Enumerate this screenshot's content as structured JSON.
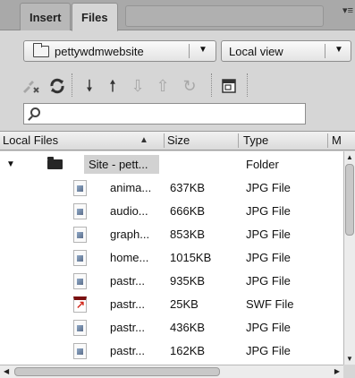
{
  "tabs": [
    {
      "label": "Insert",
      "active": false
    },
    {
      "label": "Files",
      "active": true
    }
  ],
  "site_select": {
    "value": "pettywdmwebsite"
  },
  "view_select": {
    "value": "Local view"
  },
  "toolbar": {
    "icons": [
      "connect-icon",
      "refresh-icon",
      "get-files-icon",
      "put-files-icon",
      "check-out-icon",
      "check-in-icon",
      "synchronize-icon",
      "expand-icon"
    ]
  },
  "search": {
    "value": "",
    "placeholder": ""
  },
  "columns": [
    "Local Files",
    "Size",
    "Type",
    "M"
  ],
  "sort": {
    "column": "Local Files",
    "direction": "ascending"
  },
  "tree": {
    "root": {
      "name": "Site - pett...",
      "type": "Folder",
      "expanded": true
    },
    "files": [
      {
        "name": "anima...",
        "size": "637KB",
        "type": "JPG File",
        "icon": "jpg-file-icon"
      },
      {
        "name": "audio...",
        "size": "666KB",
        "type": "JPG File",
        "icon": "jpg-file-icon"
      },
      {
        "name": "graph...",
        "size": "853KB",
        "type": "JPG File",
        "icon": "jpg-file-icon"
      },
      {
        "name": "home...",
        "size": "1015KB",
        "type": "JPG File",
        "icon": "jpg-file-icon"
      },
      {
        "name": "pastr...",
        "size": "935KB",
        "type": "JPG File",
        "icon": "jpg-file-icon"
      },
      {
        "name": "pastr...",
        "size": "25KB",
        "type": "SWF File",
        "icon": "swf-file-icon"
      },
      {
        "name": "pastr...",
        "size": "436KB",
        "type": "JPG File",
        "icon": "jpg-file-icon"
      },
      {
        "name": "pastr...",
        "size": "162KB",
        "type": "JPG File",
        "icon": "jpg-file-icon"
      }
    ]
  },
  "colors": {
    "panel": "#d6d6d6",
    "tabstrip": "#a9a9a9",
    "list_bg": "#ffffff",
    "selection_bg": "#d2d2d2"
  }
}
